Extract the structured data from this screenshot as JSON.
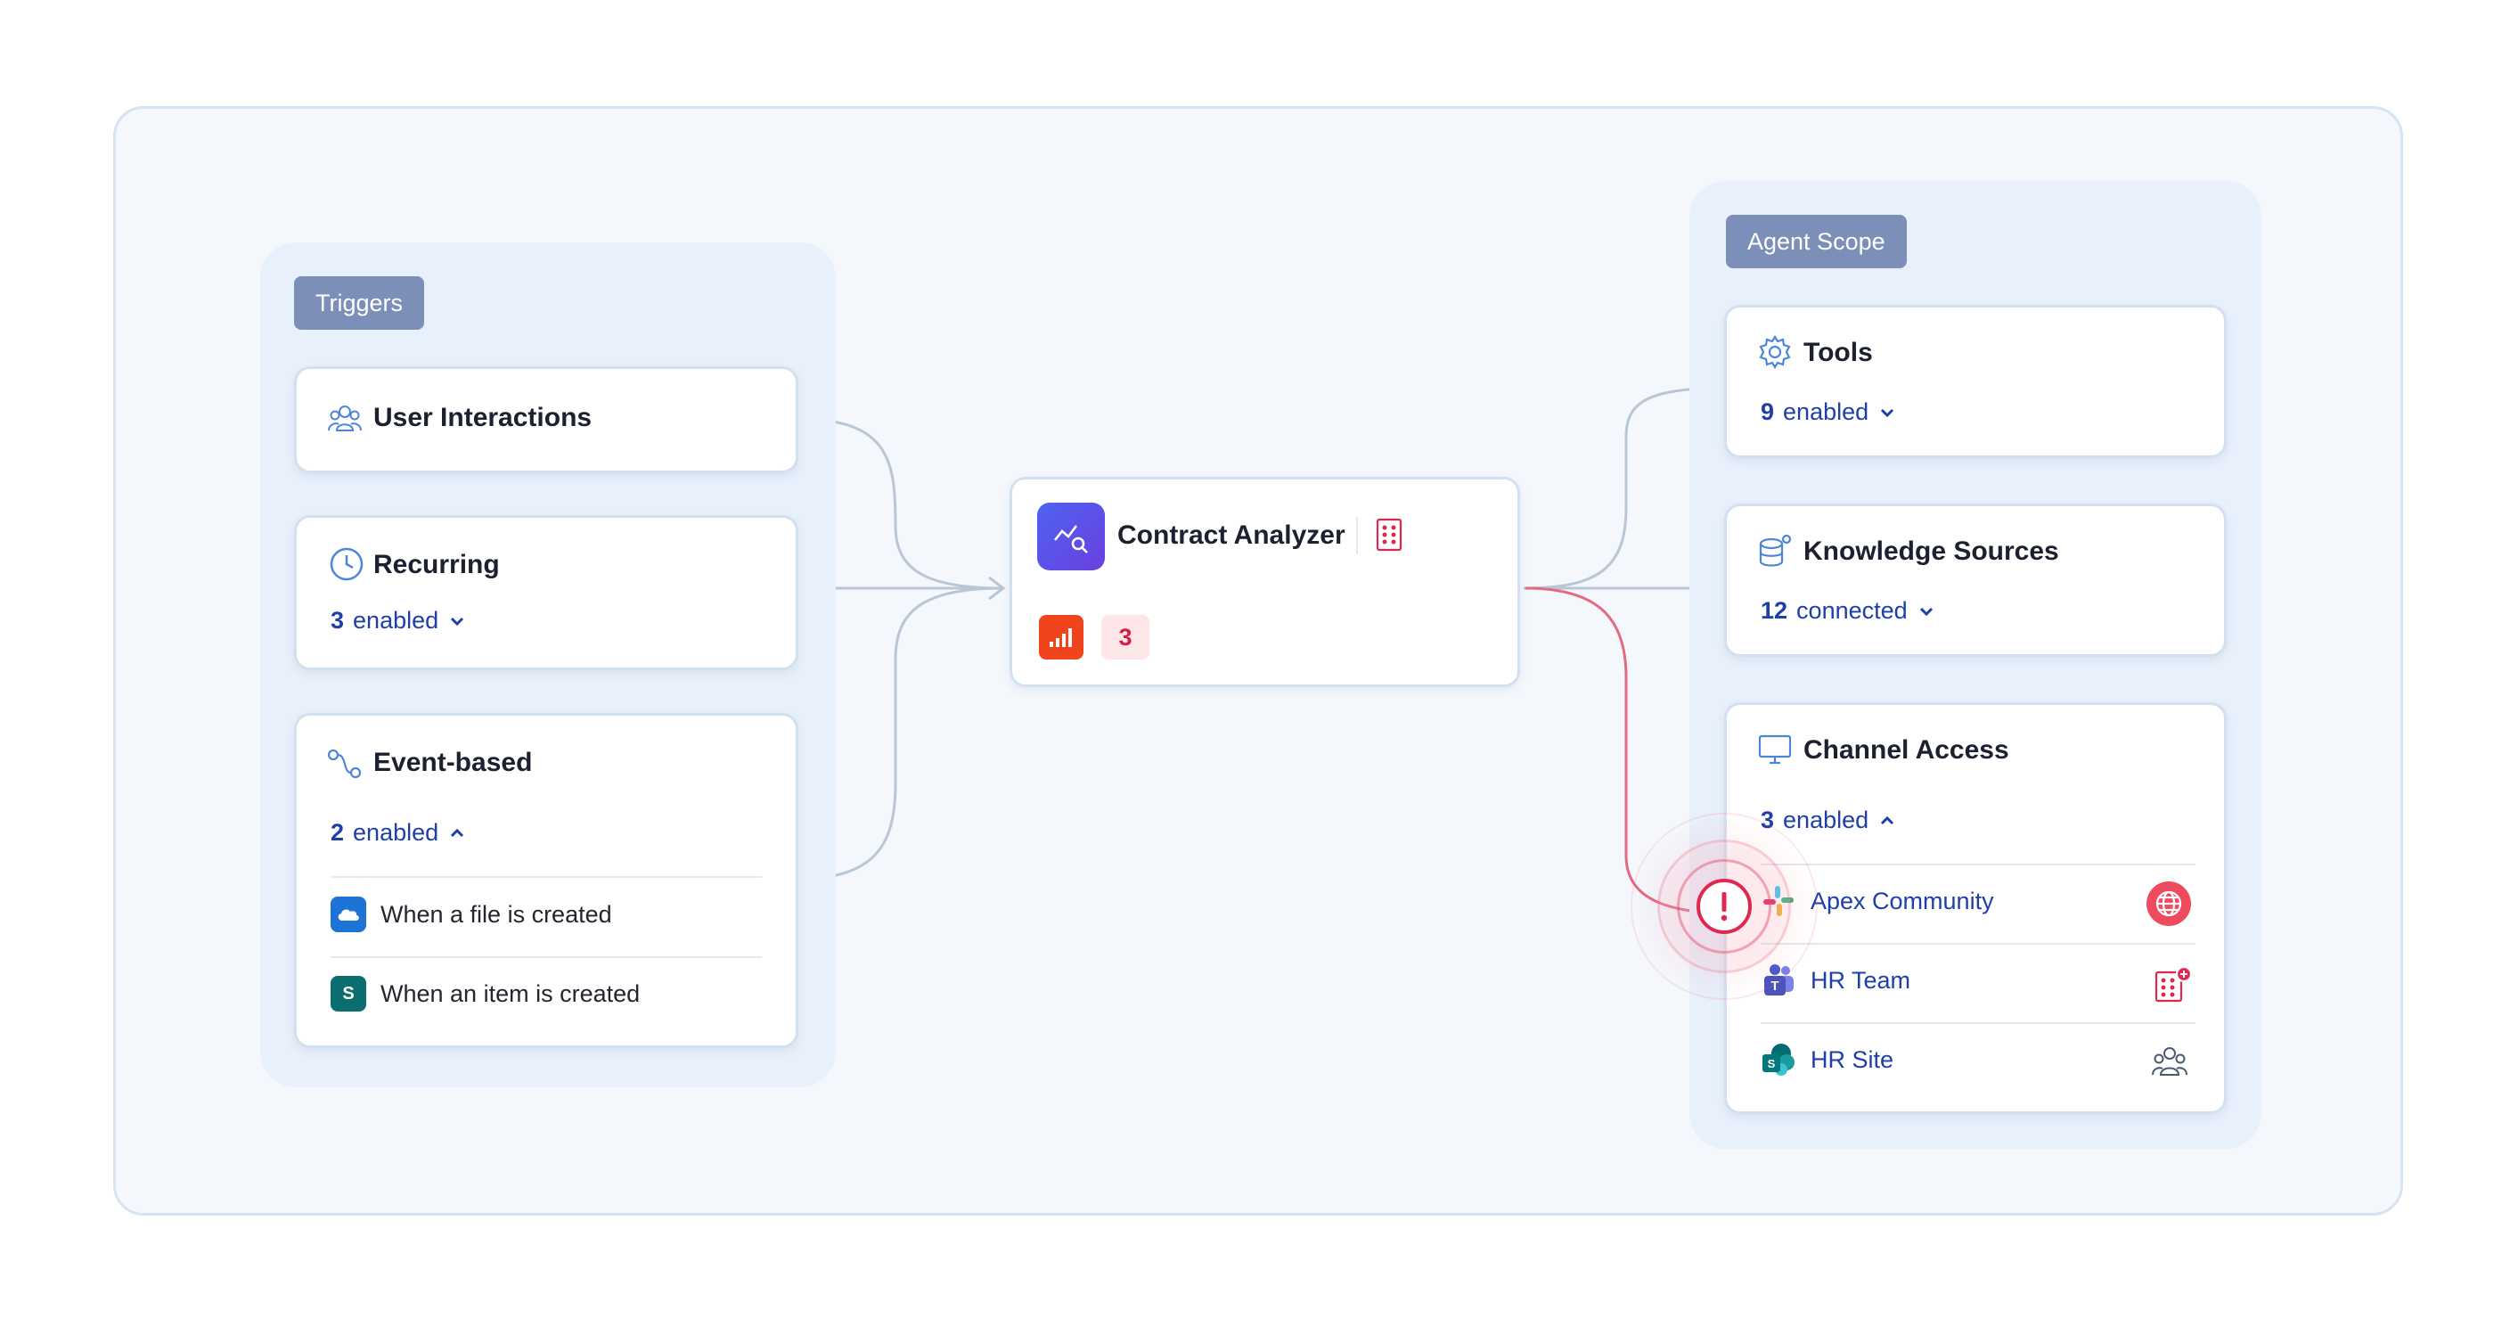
{
  "triggers": {
    "label": "Triggers",
    "user_interactions": {
      "title": "User Interactions"
    },
    "recurring": {
      "title": "Recurring",
      "count": "3",
      "status": "enabled"
    },
    "event_based": {
      "title": "Event-based",
      "count": "2",
      "status": "enabled",
      "items": [
        {
          "label": "When a file is created",
          "icon": "onedrive-icon"
        },
        {
          "label": "When an item is created",
          "icon": "sharepoint-icon"
        }
      ]
    }
  },
  "agent": {
    "name": "Contract Analyzer",
    "issue_count": "3",
    "icon": "analytics-search-icon"
  },
  "scope": {
    "label": "Agent Scope",
    "tools": {
      "title": "Tools",
      "count": "9",
      "status": "enabled"
    },
    "knowledge": {
      "title": "Knowledge Sources",
      "count": "12",
      "status": "connected"
    },
    "channels": {
      "title": "Channel Access",
      "count": "3",
      "status": "enabled",
      "items": [
        {
          "label": "Apex Community",
          "icon": "slack-icon",
          "badge": "globe-icon"
        },
        {
          "label": "HR Team",
          "icon": "teams-icon",
          "badge": "building-alert-icon"
        },
        {
          "label": "HR Site",
          "icon": "sharepoint-icon",
          "badge": "people-icon"
        }
      ]
    }
  },
  "colors": {
    "link_blue": "#1f3fa8",
    "alert_red": "#e0284f",
    "connector_gray": "#b9c6d6",
    "group_label": "#7b8fb8"
  }
}
